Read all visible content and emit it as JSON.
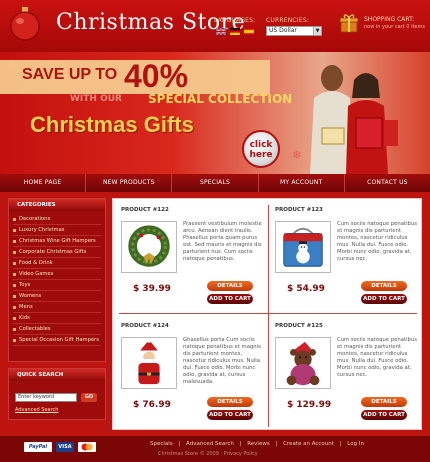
{
  "header": {
    "store_title": "Christmas Store",
    "languages_label": "LANGUAGES:",
    "currencies_label": "CURRENCIES:",
    "currency_value": "US Dollar",
    "cart_label": "SHOPPING CART:",
    "cart_sub": "now in your cart 0 items"
  },
  "banner": {
    "save": "SAVE UP TO",
    "percent": "40%",
    "with_our": "WITH OUR",
    "special": "SPECIAL COLLECTION",
    "gifts": "Christmas Gifts",
    "click_here": "click here"
  },
  "nav": [
    "HOME PAGE",
    "NEW PRODUCTS",
    "SPECIALS",
    "MY ACCOUNT",
    "CONTACT US"
  ],
  "sidebar": {
    "categories_title": "CATEGORIES",
    "categories": [
      "Decorations",
      "Luxury Christmas",
      "Christmas Wine Gift Hampers",
      "Corporate Christmas Gifts",
      "Food & Drink",
      "Video Games",
      "Toys",
      "Womens",
      "Mens",
      "Kids",
      "Collectables",
      "Special Occasion Gift Hampers"
    ],
    "search_title": "QUICK SEARCH",
    "search_value": "Enter keyword",
    "go_label": "GO",
    "advanced_search": "Advanced Search"
  },
  "products": [
    {
      "title": "PRODUCT #122",
      "desc": "Praesent vestibulum molestie arcu. Aenean dient iraulis. Phasellus porta quam purus est. Sed mauris et magnis dis parturient nus. Cum sociis natoque penatibus.",
      "price": "$ 39.99",
      "details": "DETAILS",
      "cart": "ADD TO CART",
      "image": "wreath"
    },
    {
      "title": "PRODUCT #123",
      "desc": "Cum sociis natoque penatibus et magnis dis parturient montes, nascetur ridiculus mus. Nulla dui. Fusce odio. Morbi nunc odio, gravida at, cursus nec.",
      "price": "$ 54.99",
      "details": "DETAILS",
      "cart": "ADD TO CART",
      "image": "lunchbox"
    },
    {
      "title": "PRODUCT #124",
      "desc": "Ghasellus porta Cum sociis natoque penatibus et magnis dis parturient montes, nascetur ridiculus mus. Nulla dui. Fusce odio. Morbi nunc odio, gravida at, cursus malesuada.",
      "price": "$ 76.99",
      "details": "DETAILS",
      "cart": "ADD TO CART",
      "image": "santa"
    },
    {
      "title": "PRODUCT #125",
      "desc": "Cum sociis natoque penatibus et magnis dis parturient montes, nascetur ridiculus mus. Nulla dui. Fusce odio. Morbi nunc odio, gravida at, cursus nec.",
      "price": "$ 129.99",
      "details": "DETAILS",
      "cart": "ADD TO CART",
      "image": "teddy"
    }
  ],
  "footer": {
    "links": [
      "Specials",
      "|",
      "Advanced Search",
      "|",
      "Reviews",
      "|",
      "Create an Account",
      "|",
      "Log In"
    ],
    "copyright": "Christmas Store © 2009 · Privacy Policy",
    "payments": [
      "PayPal",
      "VISA",
      "MC"
    ]
  },
  "colors": {
    "primary_red": "#bd1410",
    "dark_red": "#7a0606",
    "orange_button": "#f06a20",
    "gold": "#ffd050"
  }
}
